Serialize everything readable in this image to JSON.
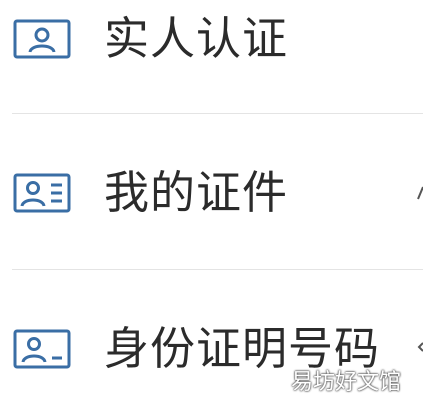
{
  "colors": {
    "icon_stroke": "#3a6ea5",
    "text": "#2b2b2b",
    "divider": "#e4e4e4"
  },
  "menu": {
    "items": [
      {
        "label": "实人认证",
        "icon": "person-card-icon"
      },
      {
        "label": "我的证件",
        "icon": "id-card-lines-icon"
      },
      {
        "label": "身份证明号码",
        "icon": "id-card-dash-icon"
      }
    ]
  },
  "watermark": "易坊好文馆"
}
